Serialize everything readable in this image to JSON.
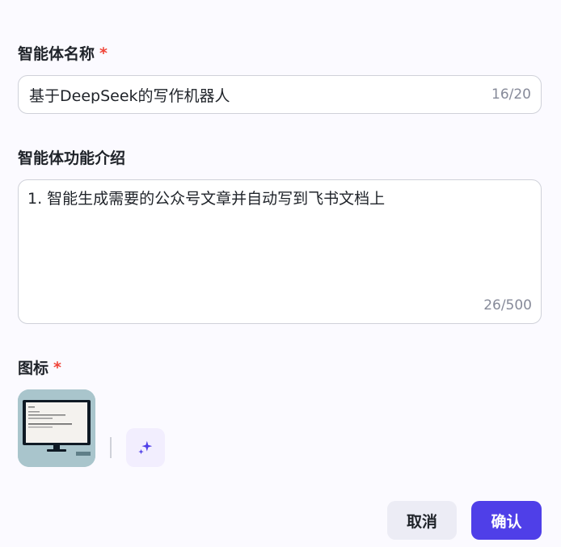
{
  "form": {
    "top_title": "",
    "name": {
      "label": "智能体名称",
      "required_mark": "*",
      "value": "基于DeepSeek的写作机器人",
      "counter": "16/20"
    },
    "description": {
      "label": "智能体功能介绍",
      "value": "1. 智能生成需要的公众号文章并自动写到飞书文档上",
      "counter": "26/500"
    },
    "icon": {
      "label": "图标",
      "required_mark": "*",
      "ai_generate_icon": "sparkle-icon"
    }
  },
  "footer": {
    "cancel_label": "取消",
    "confirm_label": "确认"
  },
  "colors": {
    "accent": "#4f3fe8",
    "required": "#f04438",
    "border": "#cfd1d9",
    "background": "#fbfaff"
  }
}
